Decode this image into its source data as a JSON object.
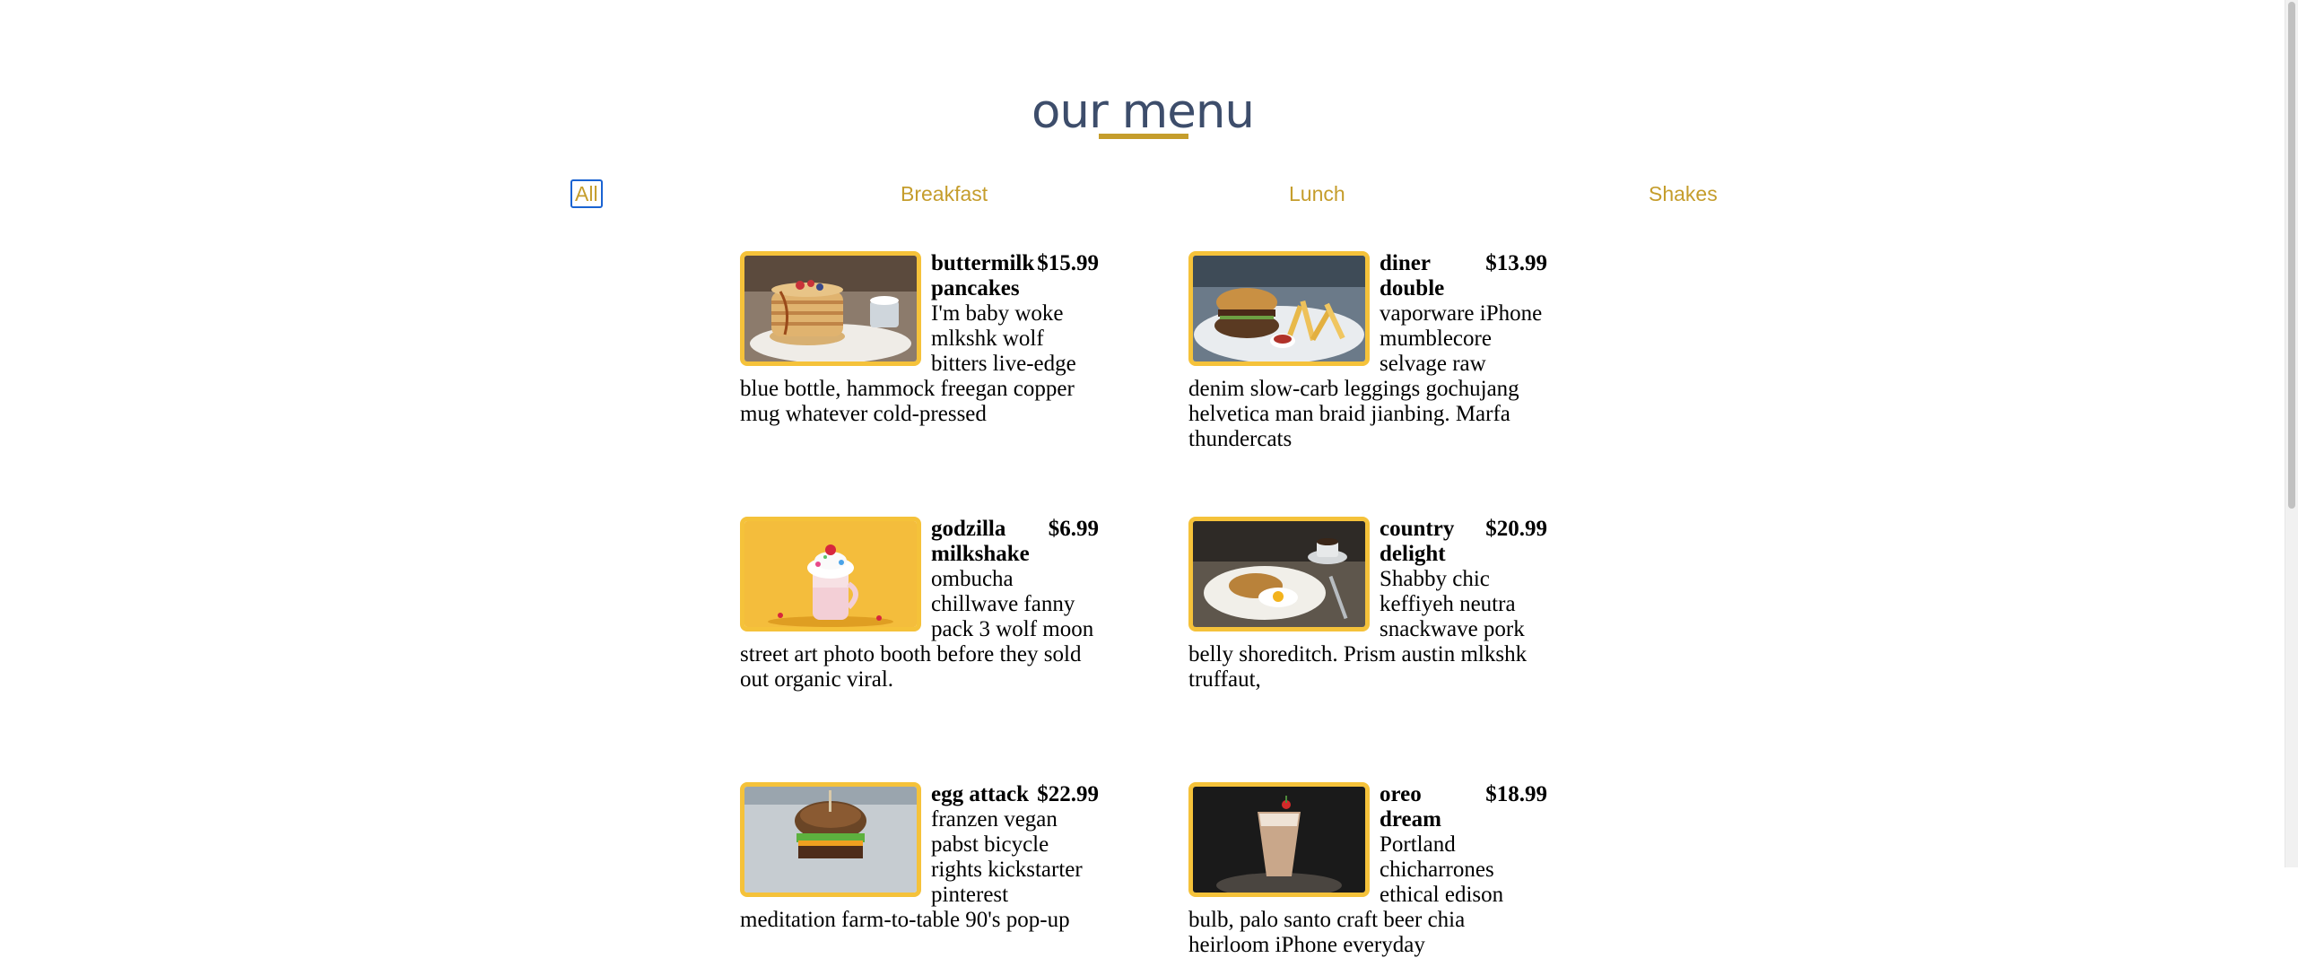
{
  "page": {
    "title": "our menu"
  },
  "filters": {
    "all": "All",
    "breakfast": "Breakfast",
    "lunch": "Lunch",
    "shakes": "Shakes"
  },
  "colors": {
    "accent": "#c59d2c",
    "title": "#3d4d6b",
    "photo_border": "#f5c23a",
    "focus_outline": "#1a63d2"
  },
  "menu": {
    "items": [
      {
        "name": "buttermilk pancakes",
        "price": "$15.99",
        "description": "I'm baby woke mlkshk wolf bitters live-edge blue bottle, hammock freegan copper mug whatever cold-pressed"
      },
      {
        "name": "diner double",
        "price": "$13.99",
        "description": "vaporware iPhone mumblecore selvage raw denim slow-carb leggings gochujang helvetica man braid jianbing. Marfa thundercats"
      },
      {
        "name": "godzilla milkshake",
        "price": "$6.99",
        "description": "ombucha chillwave fanny pack 3 wolf moon street art photo booth before they sold out organic viral."
      },
      {
        "name": "country delight",
        "price": "$20.99",
        "description": "Shabby chic keffiyeh neutra snackwave pork belly shoreditch. Prism austin mlkshk truffaut,"
      },
      {
        "name": "egg attack",
        "price": "$22.99",
        "description": "franzen vegan pabst bicycle rights kickstarter pinterest meditation farm-to-table 90's pop-up"
      },
      {
        "name": "oreo dream",
        "price": "$18.99",
        "description": "Portland chicharrones ethical edison bulb, palo santo craft beer chia heirloom iPhone everyday"
      }
    ]
  }
}
